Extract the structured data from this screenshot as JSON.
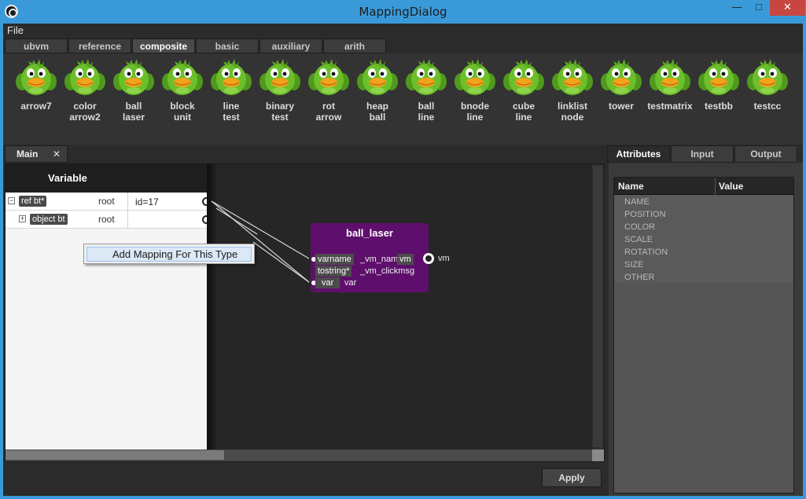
{
  "window": {
    "title": "MappingDialog",
    "min_glyph": "—",
    "max_glyph": "□",
    "close_glyph": "✕"
  },
  "menu": {
    "file": "File"
  },
  "top_tabs": [
    "ubvm",
    "reference",
    "composite",
    "basic",
    "auxiliary",
    "arith"
  ],
  "active_top_tab": "composite",
  "palette": [
    {
      "line1": "arrow7",
      "line2": ""
    },
    {
      "line1": "color",
      "line2": "arrow2"
    },
    {
      "line1": "ball",
      "line2": "laser"
    },
    {
      "line1": "block",
      "line2": "unit"
    },
    {
      "line1": "line",
      "line2": "test"
    },
    {
      "line1": "binary",
      "line2": "test"
    },
    {
      "line1": "rot",
      "line2": "arrow"
    },
    {
      "line1": "heap",
      "line2": "ball"
    },
    {
      "line1": "ball",
      "line2": "line"
    },
    {
      "line1": "bnode",
      "line2": "line"
    },
    {
      "line1": "cube",
      "line2": "line"
    },
    {
      "line1": "linklist",
      "line2": "node"
    },
    {
      "line1": "tower",
      "line2": ""
    },
    {
      "line1": "testmatrix",
      "line2": ""
    },
    {
      "line1": "testbb",
      "line2": ""
    },
    {
      "line1": "testcc",
      "line2": ""
    }
  ],
  "main_tab": {
    "label": "Main",
    "close_glyph": "✕"
  },
  "variable_panel": {
    "header": "Variable",
    "rows": [
      {
        "expander": "−",
        "tag": "ref bt*",
        "root": "root",
        "value": "id=17"
      },
      {
        "expander": "+",
        "tag": "object bt",
        "root": "root",
        "value": ""
      }
    ]
  },
  "context_menu": {
    "item": "Add Mapping For This Type"
  },
  "node": {
    "title": "ball_laser",
    "rows": [
      {
        "pill": "varname",
        "text": "_vm_nam",
        "pill2": "vm"
      },
      {
        "pill": "tostring*",
        "text": "_vm_clickmsg"
      },
      {
        "pill": "var",
        "text": "var"
      }
    ],
    "output_label": "vm"
  },
  "apply_button": "Apply",
  "right_tabs": [
    "Attributes",
    "Input",
    "Output"
  ],
  "active_right_tab": "Attributes",
  "attributes": {
    "col_name": "Name",
    "col_value": "Value",
    "rows": [
      "NAME",
      "POSITION",
      "COLOR",
      "SCALE",
      "ROTATION",
      "SIZE",
      "OTHER"
    ]
  },
  "colors": {
    "titlebar": "#3a9ad9",
    "node_fill": "#5e0f6b",
    "bird_green": "#6cbf2a",
    "bird_beak": "#f2a21b"
  }
}
